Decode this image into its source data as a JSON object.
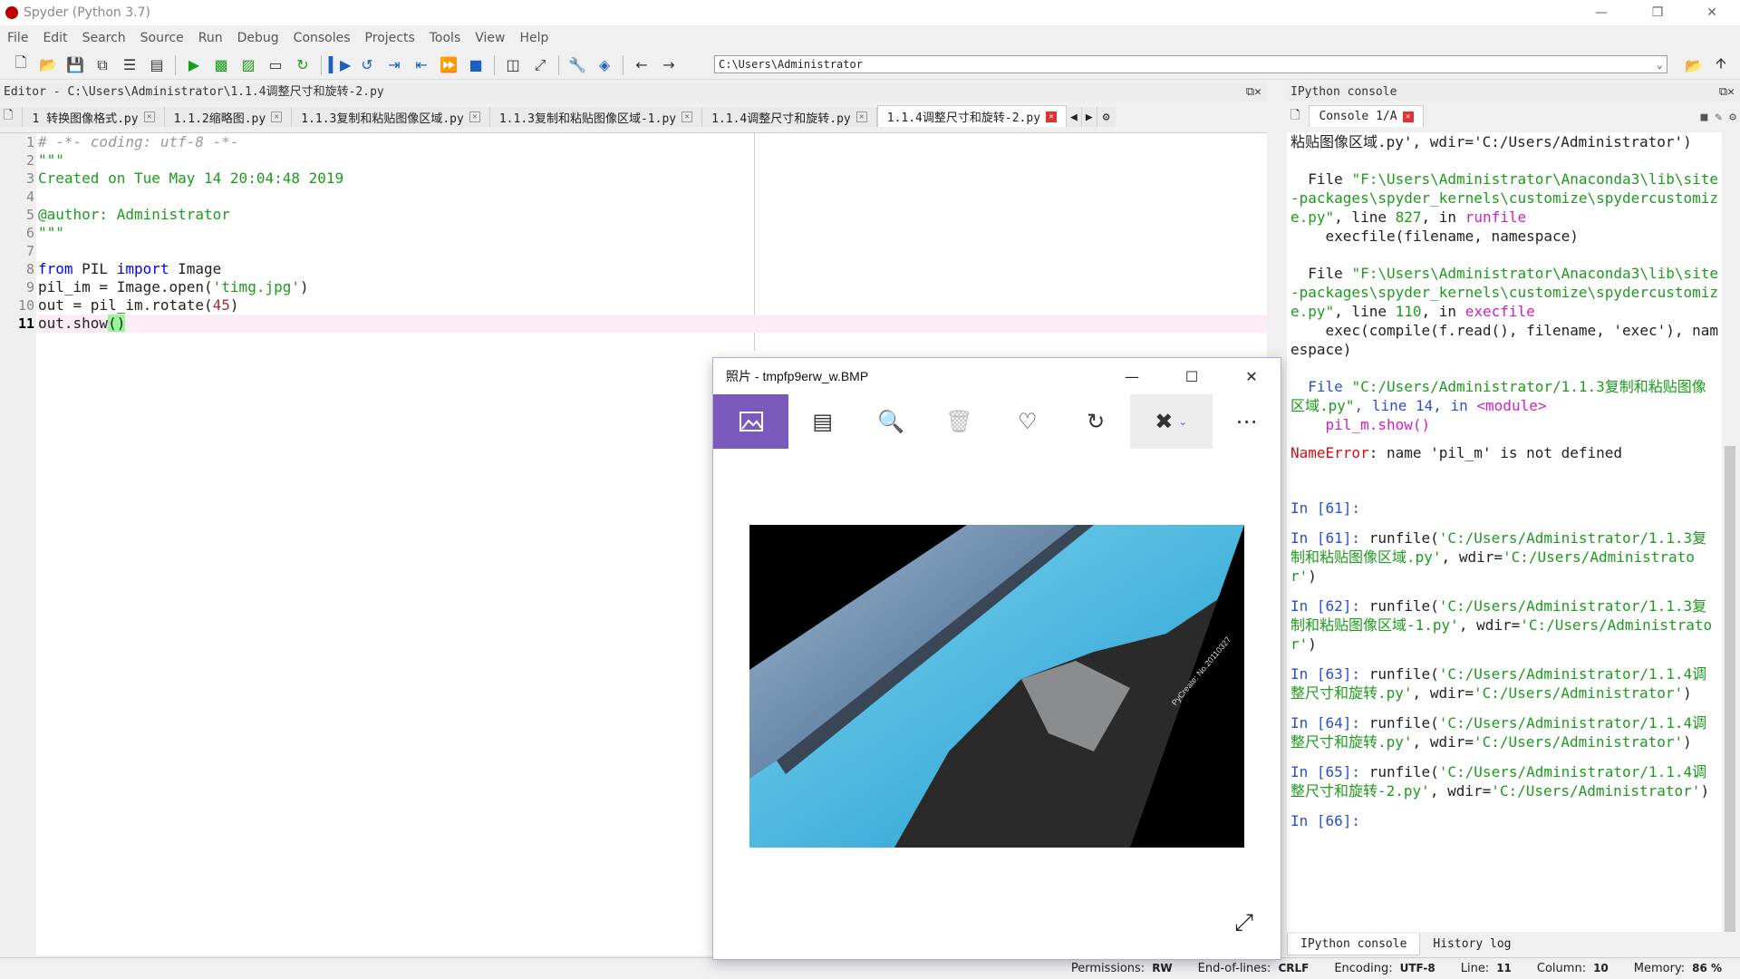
{
  "window": {
    "title": "Spyder (Python 3.7)"
  },
  "menu": [
    "File",
    "Edit",
    "Search",
    "Source",
    "Run",
    "Debug",
    "Consoles",
    "Projects",
    "Tools",
    "View",
    "Help"
  ],
  "toolbar": {
    "path": "C:\\Users\\Administrator"
  },
  "editor": {
    "header": "Editor - C:\\Users\\Administrator\\1.1.4调整尺寸和旋转-2.py",
    "tabs": [
      {
        "label": "1 转换图像格式.py"
      },
      {
        "label": "1.1.2缩略图.py"
      },
      {
        "label": "1.1.3复制和粘贴图像区域.py"
      },
      {
        "label": "1.1.3复制和粘贴图像区域-1.py"
      },
      {
        "label": "1.1.4调整尺寸和旋转.py"
      },
      {
        "label": "1.1.4调整尺寸和旋转-2.py"
      }
    ],
    "line_numbers": [
      "1",
      "2",
      "3",
      "4",
      "5",
      "6",
      "7",
      "8",
      "9",
      "10",
      "11"
    ],
    "code": {
      "l1": "# -*- coding: utf-8 -*-",
      "l2": "\"\"\"",
      "l3": "Created on Tue May 14 20:04:48 2019",
      "l4": "",
      "l5": "@author: Administrator",
      "l6": "\"\"\"",
      "l7": "",
      "l8_from": "from",
      "l8_mod": " PIL ",
      "l8_import": "import",
      "l8_rest": " Image",
      "l9_a": "pil_im = Image.open(",
      "l9_s": "'timg.jpg'",
      "l9_b": ")",
      "l10_a": "out = pil_im.rotate(",
      "l10_n": "45",
      "l10_b": ")",
      "l11_a": "out.show",
      "l11_p": "()"
    }
  },
  "console": {
    "header": "IPython console",
    "tab": "Console 1/A",
    "bottom_tabs": [
      "IPython console",
      "History log"
    ],
    "lines": {
      "c0": "粘贴图像区域.py', wdir='C:/Users/Administrator')",
      "f1_pre": "  File ",
      "f1_path": "\"F:\\Users\\Administrator\\Anaconda3\\lib\\site-packages\\spyder_kernels\\customize\\spydercustomize.py\"",
      "f1_mid": ", line ",
      "f1_line": "827",
      "f1_in": ", in ",
      "f1_fn": "runfile",
      "f1_code": "    execfile(filename, namespace)",
      "f2_pre": "  File ",
      "f2_path": "\"F:\\Users\\Administrator\\Anaconda3\\lib\\site-packages\\spyder_kernels\\customize\\spydercustomize.py\"",
      "f2_mid": ", line ",
      "f2_line": "110",
      "f2_in": ", in ",
      "f2_fn": "execfile",
      "f2_code": "    exec(compile(f.read(), filename, 'exec'), namespace)",
      "f3_pre": "  File ",
      "f3_path": "\"C:/Users/Administrator/1.1.3复制和粘贴图像区域.py\"",
      "f3_mid": ", line 14, in ",
      "f3_fn": "<module>",
      "f3_code": "    pil_m.show()",
      "err_type": "NameError",
      "err_msg": ": name 'pil_m' is not defined",
      "in61a": "In [61]:",
      "in61_pre": "In [61]: ",
      "in61_call": "runfile(",
      "in61_arg": "'C:/Users/Administrator/1.1.3复制和粘贴图像区域.py'",
      "in61_w": ", wdir=",
      "in61_wd": "'C:/Users/Administrator'",
      "in61_end": ")",
      "in62_pre": "In [62]: ",
      "in62_call": "runfile(",
      "in62_arg": "'C:/Users/Administrator/1.1.3复制和粘贴图像区域-1.py'",
      "in62_w": ", wdir=",
      "in62_wd": "'C:/Users/Administrator'",
      "in62_end": ")",
      "in63_pre": "In [63]: ",
      "in63_call": "runfile(",
      "in63_arg": "'C:/Users/Administrator/1.1.4调整尺寸和旋转.py'",
      "in63_w": ", wdir=",
      "in63_wd": "'C:/Users/Administrator'",
      "in63_end": ")",
      "in64_pre": "In [64]: ",
      "in64_call": "runfile(",
      "in64_arg": "'C:/Users/Administrator/1.1.4调整尺寸和旋转.py'",
      "in64_w": ", wdir=",
      "in64_wd": "'C:/Users/Administrator'",
      "in64_end": ")",
      "in65_pre": "In [65]: ",
      "in65_call": "runfile(",
      "in65_arg": "'C:/Users/Administrator/1.1.4调整尺寸和旋转-2.py'",
      "in65_w": ", wdir=",
      "in65_wd": "'C:/Users/Administrator'",
      "in65_end": ")",
      "in66": "In [66]:"
    }
  },
  "photos": {
    "title": "照片 - tmpfp9erw_w.BMP",
    "watermark": "PyCreate: No.20110327"
  },
  "status": {
    "permissions_label": "Permissions:",
    "permissions": "RW",
    "eol_label": "End-of-lines:",
    "eol": "CRLF",
    "encoding_label": "Encoding:",
    "encoding": "UTF-8",
    "line_label": "Line:",
    "line": "11",
    "column_label": "Column:",
    "column": "10",
    "memory_label": "Memory:",
    "memory": "86 %"
  }
}
